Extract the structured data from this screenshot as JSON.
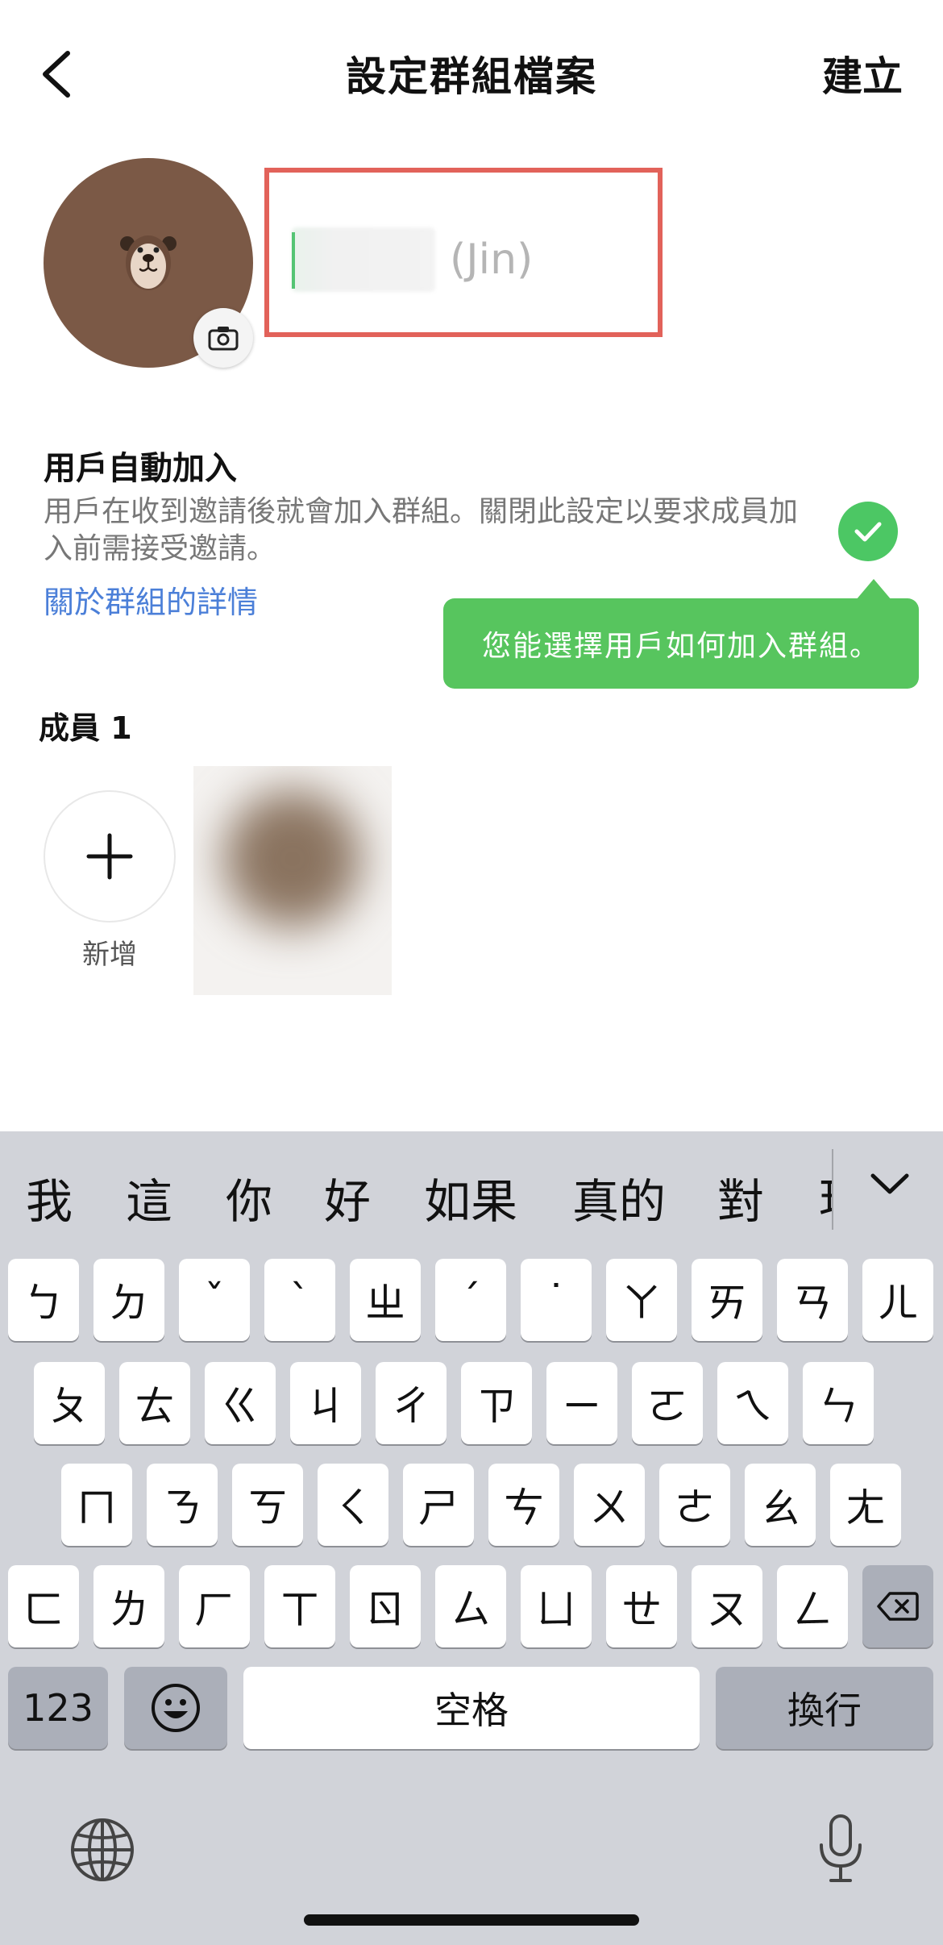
{
  "header": {
    "back_icon": "chevron-left-icon",
    "title": "設定群組檔案",
    "create_label": "建立"
  },
  "profile": {
    "avatar_icon": "brown-bear-icon",
    "camera_icon": "camera-icon",
    "name_value": "(Jin)"
  },
  "auto_join": {
    "title": "用戶自動加入",
    "description": "用戶在收到邀請後就會加入群組。關閉此設定以要求成員加入前需接受邀請。",
    "link": "關於群組的詳情",
    "toggle_on": true,
    "toggle_icon": "check-icon"
  },
  "tooltip": {
    "text": "您能選擇用戶如何加入群組。"
  },
  "members": {
    "title": "成員 1",
    "add_label": "新增",
    "add_icon": "plus-icon"
  },
  "keyboard": {
    "candidates": [
      "我",
      "這",
      "你",
      "好",
      "如果",
      "真的",
      "對",
      "現"
    ],
    "expand_icon": "chevron-down-icon",
    "rows": [
      [
        "ㄅ",
        "ㄉ",
        "ˇ",
        "ˋ",
        "ㄓ",
        "ˊ",
        "˙",
        "ㄚ",
        "ㄞ",
        "ㄢ",
        "ㄦ"
      ],
      [
        "ㄆ",
        "ㄊ",
        "ㄍ",
        "ㄐ",
        "ㄔ",
        "ㄗ",
        "ㄧ",
        "ㄛ",
        "ㄟ",
        "ㄣ"
      ],
      [
        "ㄇ",
        "ㄋ",
        "ㄎ",
        "ㄑ",
        "ㄕ",
        "ㄘ",
        "ㄨ",
        "ㄜ",
        "ㄠ",
        "ㄤ"
      ],
      [
        "ㄈ",
        "ㄌ",
        "ㄏ",
        "ㄒ",
        "ㄖ",
        "ㄙ",
        "ㄩ",
        "ㄝ",
        "ㄡ",
        "ㄥ"
      ]
    ],
    "backspace_icon": "backspace-icon",
    "numbers_label": "123",
    "emoji_icon": "emoji-icon",
    "space_label": "空格",
    "return_label": "換行",
    "globe_icon": "globe-icon",
    "mic_icon": "microphone-icon"
  }
}
